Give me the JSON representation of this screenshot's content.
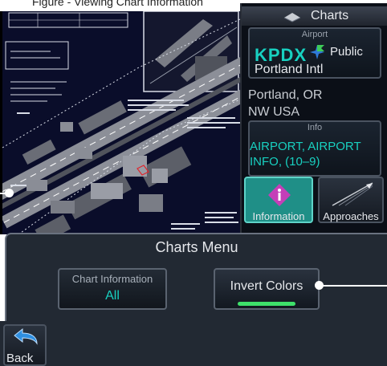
{
  "caption": {
    "text": "Figure - Viewing Chart Information"
  },
  "right_panel": {
    "header_title": "Charts",
    "header_icon": "charts-book-icon",
    "airport_tile": {
      "header": "Airport",
      "identifier": "KPDX",
      "ownership": "Public",
      "ownership_icon": "public-airport-icon",
      "name": "Portland Intl"
    },
    "city": "Portland, OR",
    "region": "NW USA",
    "info_tile": {
      "header": "Info",
      "value_line1": "AIRPORT, AIRPORT",
      "value_line2": "INFO, (10–9)"
    },
    "information_button": {
      "label": "Information",
      "icon": "information-icon"
    },
    "approaches_button": {
      "label": "Approaches",
      "icon": "approach-path-icon"
    }
  },
  "charts_menu": {
    "title": "Charts Menu",
    "chart_information": {
      "label": "Chart Information",
      "value": "All"
    },
    "invert_colors": {
      "label": "Invert Colors",
      "state": "on"
    }
  },
  "bottom_bar": {
    "back_label": "Back",
    "back_icon": "back-arrow-icon"
  },
  "colors": {
    "accent_cyan": "#18d0c0",
    "indicator_green": "#3ee06a",
    "chart_background": "#0a0d2a"
  }
}
